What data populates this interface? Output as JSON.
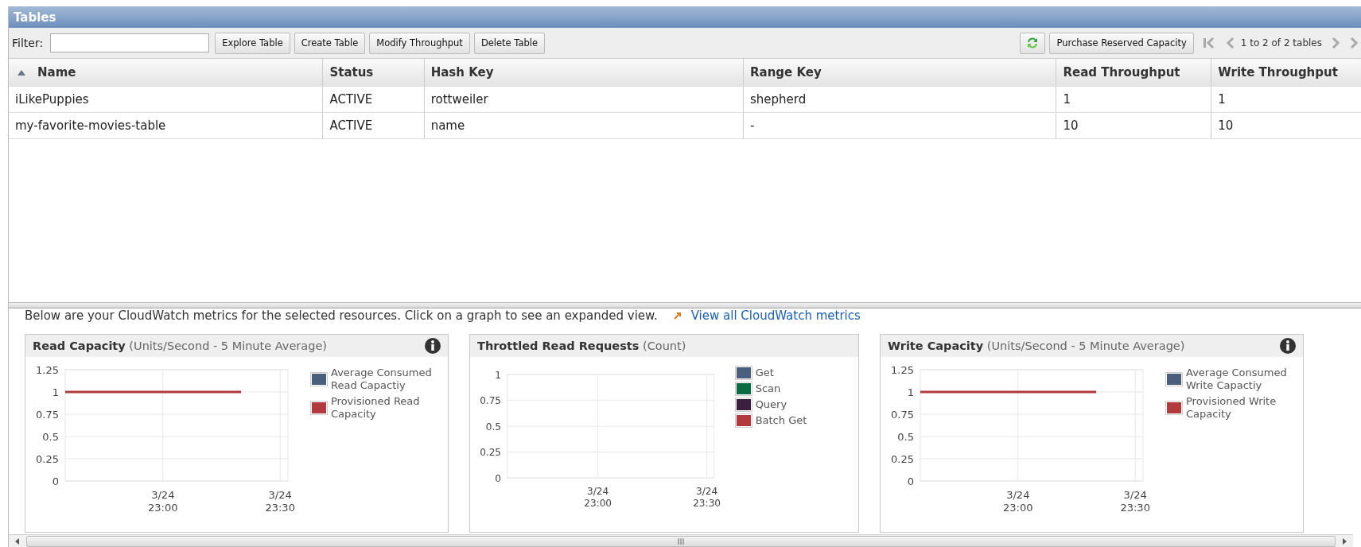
{
  "panel": {
    "title": "Tables"
  },
  "toolbar": {
    "filter_label": "Filter:",
    "buttons": [
      "Explore Table",
      "Create Table",
      "Modify Throughput",
      "Delete Table"
    ],
    "purchase_button": "Purchase Reserved Capacity",
    "pager_text": "1 to 2 of 2 tables"
  },
  "table": {
    "columns": [
      {
        "label": "Name",
        "sorted": true
      },
      {
        "label": "Status",
        "sorted": false
      },
      {
        "label": "Hash Key",
        "sorted": false
      },
      {
        "label": "Range Key",
        "sorted": false
      },
      {
        "label": "Read Throughput",
        "sorted": false
      },
      {
        "label": "Write Throughput",
        "sorted": false
      }
    ],
    "rows": [
      {
        "cells": [
          "iLikePuppies",
          "ACTIVE",
          "rottweiler",
          "shepherd",
          "1",
          "1"
        ]
      },
      {
        "cells": [
          "my-favorite-movies-table",
          "ACTIVE",
          "name",
          "-",
          "10",
          "10"
        ]
      }
    ]
  },
  "metrics": {
    "intro": "Below are your CloudWatch metrics for the selected resources. Click on a graph to see an expanded view.",
    "link": "View all CloudWatch metrics",
    "charts": [
      {
        "title": "Read Capacity",
        "unit": "(Units/Second - 5 Minute Average)",
        "info": true,
        "chart_data": {
          "type": "line",
          "grid": true,
          "categories": [
            null,
            null,
            null,
            null,
            null,
            "3/24 23:00",
            null,
            null,
            null,
            null,
            null,
            "3/24 23:30"
          ],
          "ylim": [
            0,
            1.25
          ],
          "yticks": [
            0,
            0.25,
            0.5,
            0.75,
            1,
            1.25
          ],
          "series": [
            {
              "name": "Average Consumed Read Capactiy",
              "color": "#4a5f7e",
              "values": [
                null,
                null,
                null,
                null,
                null,
                null,
                null,
                null,
                null,
                null,
                null,
                null
              ]
            },
            {
              "name": "Provisioned Read Capacity",
              "color": "#b23a3d",
              "values": [
                1,
                1,
                1,
                1,
                1,
                1,
                1,
                1,
                1,
                1,
                null,
                null
              ]
            }
          ]
        }
      },
      {
        "title": "Throttled Read Requests",
        "unit": "(Count)",
        "info": false,
        "chart_data": {
          "type": "line",
          "grid": true,
          "categories": [
            null,
            null,
            null,
            null,
            null,
            "3/24 23:00",
            null,
            null,
            null,
            null,
            null,
            "3/24 23:30"
          ],
          "ylim": [
            0,
            1
          ],
          "yticks": [
            0,
            0.25,
            0.5,
            0.75,
            1
          ],
          "series": [
            {
              "name": "Get",
              "color": "#4a5f7e",
              "values": [
                null,
                null,
                null,
                null,
                null,
                null,
                null,
                null,
                null,
                null,
                null,
                null
              ]
            },
            {
              "name": "Scan",
              "color": "#0b6b45",
              "values": [
                null,
                null,
                null,
                null,
                null,
                null,
                null,
                null,
                null,
                null,
                null,
                null
              ]
            },
            {
              "name": "Query",
              "color": "#3b1f3f",
              "values": [
                null,
                null,
                null,
                null,
                null,
                null,
                null,
                null,
                null,
                null,
                null,
                null
              ]
            },
            {
              "name": "Batch Get",
              "color": "#b23a3d",
              "values": [
                null,
                null,
                null,
                null,
                null,
                null,
                null,
                null,
                null,
                null,
                null,
                null
              ]
            }
          ]
        }
      },
      {
        "title": "Write Capacity",
        "unit": "(Units/Second - 5 Minute Average)",
        "info": true,
        "chart_data": {
          "type": "line",
          "grid": true,
          "categories": [
            null,
            null,
            null,
            null,
            null,
            "3/24 23:00",
            null,
            null,
            null,
            null,
            null,
            "3/24 23:30"
          ],
          "ylim": [
            0,
            1.25
          ],
          "yticks": [
            0,
            0.25,
            0.5,
            0.75,
            1,
            1.25
          ],
          "series": [
            {
              "name": "Average Consumed Write Capactiy",
              "color": "#4a5f7e",
              "values": [
                null,
                null,
                null,
                null,
                null,
                null,
                null,
                null,
                null,
                null,
                null,
                null
              ]
            },
            {
              "name": "Provisioned Write Capacity",
              "color": "#b23a3d",
              "values": [
                1,
                1,
                1,
                1,
                1,
                1,
                1,
                1,
                1,
                1,
                null,
                null
              ]
            }
          ]
        }
      }
    ]
  }
}
